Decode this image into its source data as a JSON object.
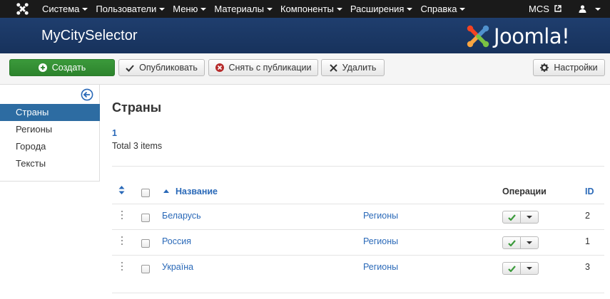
{
  "topbar": {
    "menu": [
      {
        "label": "Система"
      },
      {
        "label": "Пользователи"
      },
      {
        "label": "Меню"
      },
      {
        "label": "Материалы"
      },
      {
        "label": "Компоненты"
      },
      {
        "label": "Расширения"
      },
      {
        "label": "Справка"
      }
    ],
    "site_label": "MCS"
  },
  "header": {
    "title": "MyCitySelector",
    "brand": "Joomla!"
  },
  "toolbar": {
    "new_label": "Создать",
    "publish_label": "Опубликовать",
    "unpublish_label": "Снять с публикации",
    "delete_label": "Удалить",
    "options_label": "Настройки"
  },
  "sidebar": {
    "items": [
      {
        "label": "Страны",
        "active": true
      },
      {
        "label": "Регионы",
        "active": false
      },
      {
        "label": "Города",
        "active": false
      },
      {
        "label": "Тексты",
        "active": false
      }
    ]
  },
  "main": {
    "title": "Страны",
    "page": "1",
    "total": "Total 3 items",
    "columns": {
      "name": "Название",
      "operations": "Операции",
      "id": "ID"
    },
    "rows": [
      {
        "name": "Беларусь",
        "link": "Регионы",
        "published": true,
        "id": "2"
      },
      {
        "name": "Россия",
        "link": "Регионы",
        "published": true,
        "id": "1"
      },
      {
        "name": "Україна",
        "link": "Регионы",
        "published": true,
        "id": "3"
      }
    ]
  },
  "colors": {
    "topbar": "#1a1a1a",
    "header": "#1f3e6e",
    "link": "#2a69b8",
    "active": "#2d6ca2",
    "success": "#3b9a3b"
  }
}
